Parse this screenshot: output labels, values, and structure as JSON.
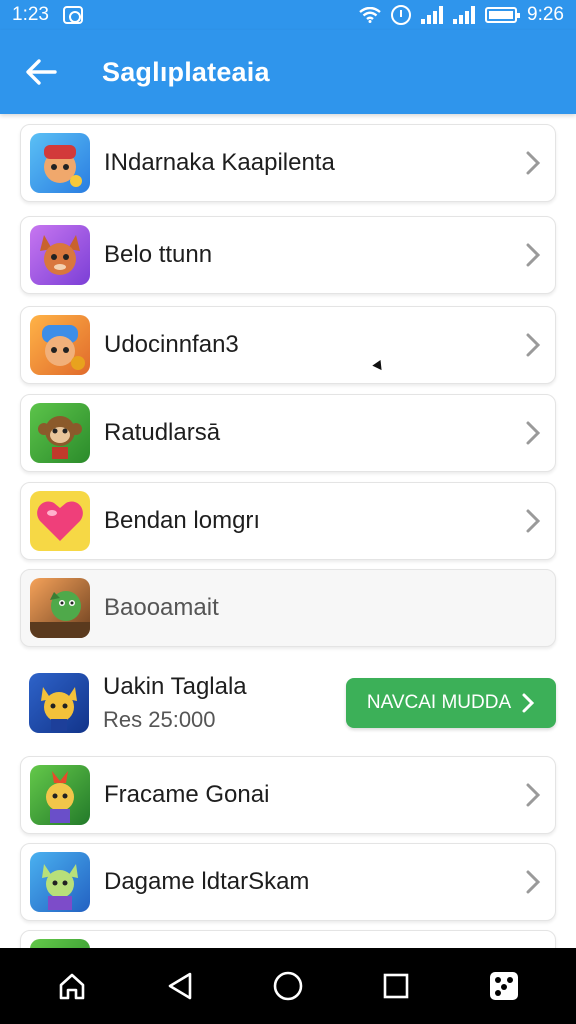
{
  "status_bar": {
    "time_left": "1:23",
    "time_right": "9:26"
  },
  "app_bar": {
    "title": "Saglıplateaia"
  },
  "games": [
    {
      "name": "INdarnaka Kaapilenta",
      "icon": "hero-boy-icon"
    },
    {
      "name": "Belo ttunn",
      "icon": "fox-character-icon"
    },
    {
      "name": "Udocinnfan3",
      "icon": "warrior-character-icon"
    },
    {
      "name": "Ratudlarsā",
      "icon": "monkey-character-icon"
    },
    {
      "name": "Bendan lomgrı",
      "icon": "heart-icon"
    },
    {
      "name": "Baooamait",
      "icon": "dragon-character-icon"
    },
    {
      "name": "Uakin Taglala",
      "price": "Res 25:000",
      "button_label": "NAVCAI MUDDA",
      "icon": "cat-character-icon"
    },
    {
      "name": "Fracame Gonai",
      "icon": "cat-warrior-icon"
    },
    {
      "name": "Dagame ldtarSkam",
      "icon": "cat-hero-icon"
    }
  ],
  "colors": {
    "app_bar": "#2f95ec",
    "action_button": "#3cb058",
    "nav_bar": "#000000"
  },
  "nav_icons": [
    "home-icon",
    "back-triangle-icon",
    "home-circle-icon",
    "recents-square-icon",
    "dice-icon"
  ]
}
